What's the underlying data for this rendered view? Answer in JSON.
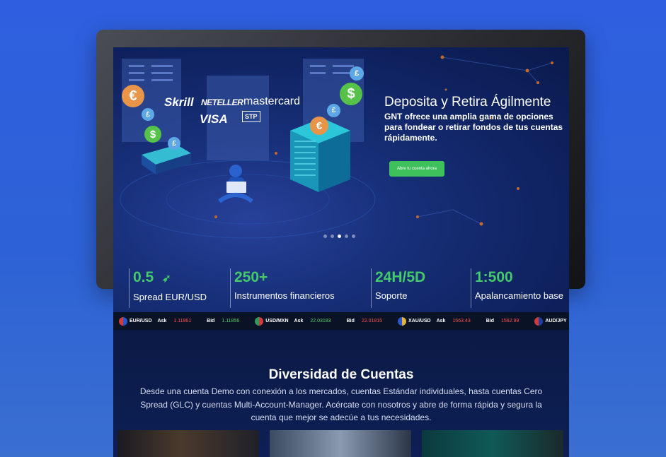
{
  "hero": {
    "title": "Deposita y Retira Ágilmente",
    "description": "GNT ofrece una amplia gama de opciones para fondear o retirar fondos de tus cuentas rápidamente.",
    "cta_label": "Abre tu cuenta ahora",
    "payment_logos": [
      "Skrill",
      "NETELLER",
      "mastercard",
      "VISA",
      "STP"
    ],
    "slides": 5,
    "active_slide": 3
  },
  "stats": [
    {
      "value": "0.5",
      "label": "Spread EUR/USD",
      "icon": "rocket-icon"
    },
    {
      "value": "250+",
      "label": "Instrumentos financieros"
    },
    {
      "value": "24H/5D",
      "label": "Soporte"
    },
    {
      "value": "1:500",
      "label": "Apalancamiento base"
    }
  ],
  "ticker": {
    "ask_label": "Ask",
    "bid_label": "Bid",
    "items": [
      {
        "pair": "EUR/USD",
        "ask": "1.11861",
        "bid": "1.11856"
      },
      {
        "pair": "USD/MXN",
        "ask": "22.03183",
        "bid": "22.01815"
      },
      {
        "pair": "XAU/USD",
        "ask": "1563.43",
        "bid": "1562.99"
      },
      {
        "pair": "AUD/JPY"
      }
    ]
  },
  "accounts": {
    "title": "Diversidad de Cuentas",
    "description": "Desde una cuenta Demo con conexión a los mercados, cuentas Estándar individuales, hasta cuentas Cero Spread (GLC) y cuentas Multi-Account-Manager. Acércate con nosotros y abre de forma rápida y segura la cuenta que mejor se adecúe a tus necesidades."
  },
  "colors": {
    "accent_green": "#43c96a",
    "cta_green": "#3ec05a",
    "ask_red": "#ff4f4f",
    "bid_green": "#4ed36f",
    "background_blue": "#2f5fe0"
  }
}
